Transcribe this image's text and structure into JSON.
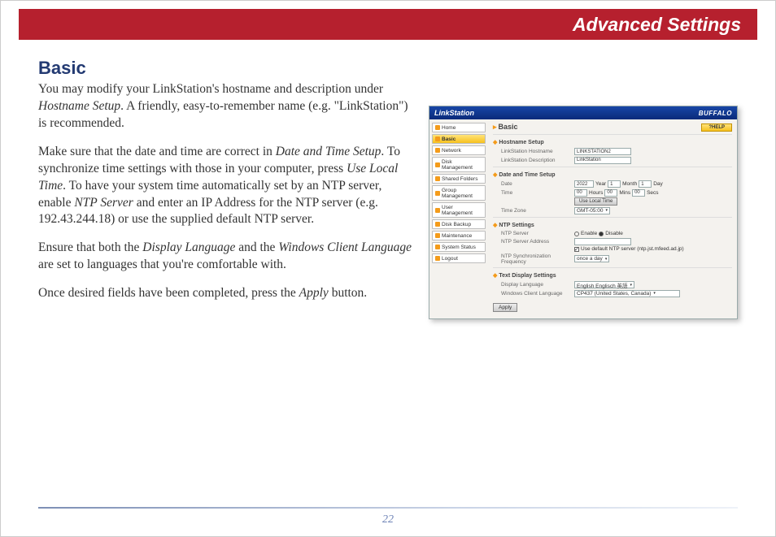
{
  "banner": {
    "title": "Advanced Settings"
  },
  "section": {
    "title": "Basic"
  },
  "paragraphs": {
    "p1a": "You may modify your LinkStation's hostname and description under ",
    "p1b": "Hostname Setup",
    "p1c": ".  A friendly, easy-to-remember name (e.g. \"LinkStation\") is recommended.",
    "p2a": "Make sure that the date and time are correct in ",
    "p2b": "Date and Time Setup",
    "p2c": ".  To synchronize time settings with those in your computer, press ",
    "p2d": "Use Local Time",
    "p2e": ". To have your system time automatically set by an NTP server, enable ",
    "p2f": "NTP Server",
    "p2g": " and enter an IP Address for the NTP server (e.g. 192.43.244.18) or use the supplied default NTP server.",
    "p3a": "Ensure that both the ",
    "p3b": "Display Language",
    "p3c": " and the ",
    "p3d": "Windows Client Language",
    "p3e": " are set to languages that you're comfortable with.",
    "p4a": "Once desired fields have been completed, press the ",
    "p4b": "Apply",
    "p4c": " button."
  },
  "screenshot": {
    "product": "LinkStation",
    "brand": "BUFFALO",
    "help": "?HELP",
    "menu": [
      "Home",
      "Basic",
      "Network",
      "Disk Management",
      "Shared Folders",
      "Group Management",
      "User Management",
      "Disk Backup",
      "Maintenance",
      "System Status",
      "Logout"
    ],
    "active_menu_index": 1,
    "page_title": "Basic",
    "groups": {
      "hostname": {
        "title": "Hostname Setup",
        "rows": {
          "hostname_lbl": "LinkStation Hostname",
          "hostname_val": "LINKSTATION2",
          "desc_lbl": "LinkStation Description",
          "desc_val": "LinkStation"
        }
      },
      "datetime": {
        "title": "Date and Time Setup",
        "date_lbl": "Date",
        "date_year": "2022",
        "date_year_sfx": "Year",
        "date_month": "1",
        "date_month_sfx": "Month",
        "date_day": "1",
        "date_day_sfx": "Day",
        "time_lbl": "Time",
        "time_h": "00",
        "time_h_sfx": "Hours",
        "time_m": "00",
        "time_m_sfx": "Mins",
        "time_s": "00",
        "time_s_sfx": "Secs",
        "use_local": "Use Local Time",
        "tz_lbl": "Time Zone",
        "tz_val": "GMT-05:00"
      },
      "ntp": {
        "title": "NTP Settings",
        "server_lbl": "NTP Server",
        "enable": "Enable",
        "disable": "Disable",
        "addr_lbl": "NTP Server Address",
        "default_lbl": "Use default NTP server (ntp.jst.mfeed.ad.jp)",
        "freq_lbl": "NTP Synchronization Frequency",
        "freq_val": "once a day"
      },
      "display": {
        "title": "Text Display Settings",
        "disp_lbl": "Display Language",
        "disp_val": "English Englisch 英語",
        "win_lbl": "Windows Client Language",
        "win_val": "CP437 (United States, Canada)"
      }
    },
    "apply": "Apply"
  },
  "page_number": "22"
}
